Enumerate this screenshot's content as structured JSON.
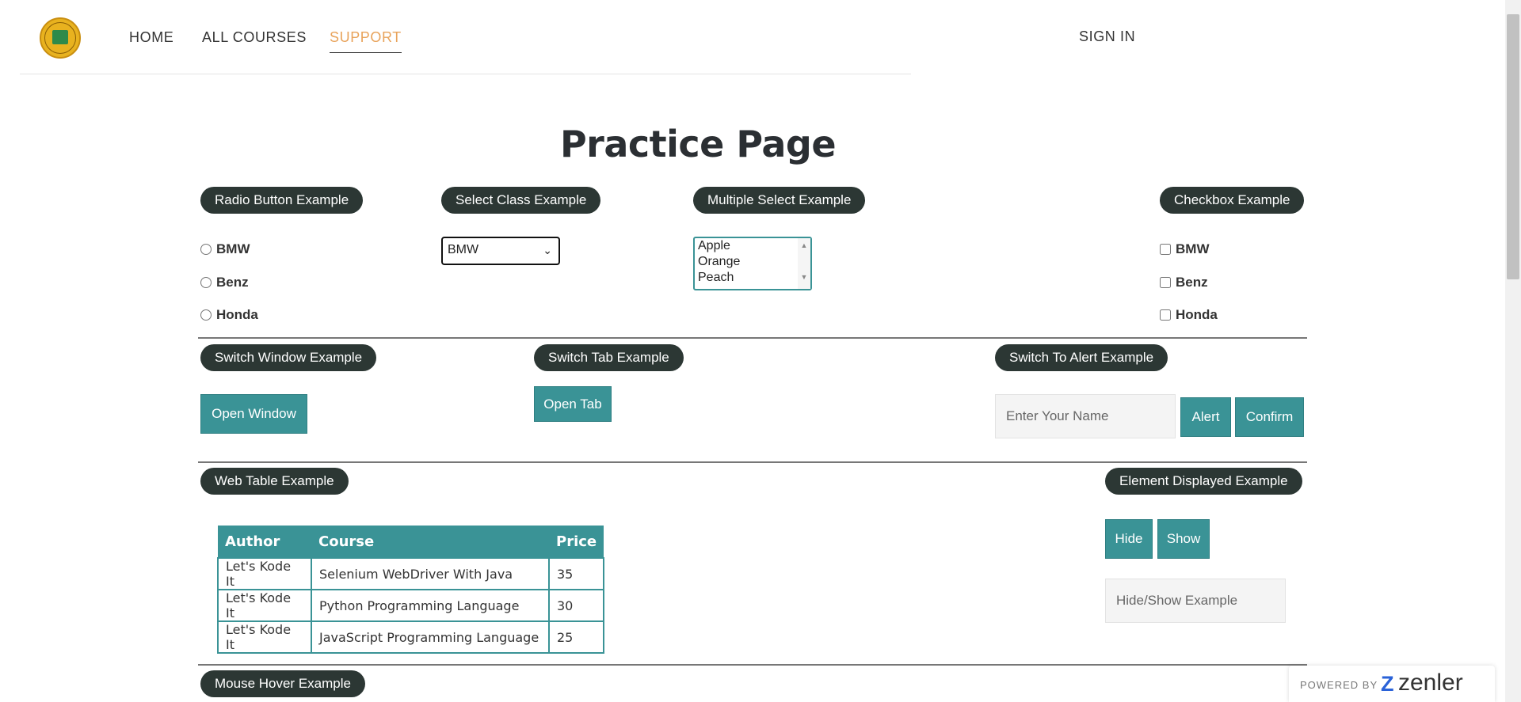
{
  "header": {
    "nav": [
      "HOME",
      "ALL COURSES",
      "SUPPORT"
    ],
    "active_nav": "SUPPORT",
    "sign_in": "SIGN IN"
  },
  "page": {
    "title": "Practice Page"
  },
  "radio": {
    "title": "Radio Button Example",
    "options": [
      "BMW",
      "Benz",
      "Honda"
    ]
  },
  "select_class": {
    "title": "Select Class Example",
    "selected": "BMW"
  },
  "multi_select": {
    "title": "Multiple Select Example",
    "options": [
      "Apple",
      "Orange",
      "Peach"
    ]
  },
  "checkbox": {
    "title": "Checkbox Example",
    "options": [
      "BMW",
      "Benz",
      "Honda"
    ]
  },
  "switch_window": {
    "title": "Switch Window Example",
    "button": "Open Window"
  },
  "switch_tab": {
    "title": "Switch Tab Example",
    "button": "Open Tab"
  },
  "alert": {
    "title": "Switch To Alert Example",
    "placeholder": "Enter Your Name",
    "alert_button": "Alert",
    "confirm_button": "Confirm"
  },
  "web_table": {
    "title": "Web Table Example",
    "headers": [
      "Author",
      "Course",
      "Price"
    ],
    "rows": [
      [
        "Let's Kode It",
        "Selenium WebDriver With Java",
        "35"
      ],
      [
        "Let's Kode It",
        "Python Programming Language",
        "30"
      ],
      [
        "Let's Kode It",
        "JavaScript Programming Language",
        "25"
      ]
    ]
  },
  "element_displayed": {
    "title": "Element Displayed Example",
    "hide": "Hide",
    "show": "Show",
    "placeholder": "Hide/Show Example"
  },
  "mouse_hover": {
    "title": "Mouse Hover Example"
  },
  "badge": {
    "powered_by": "POWERED BY",
    "brand": "zenler"
  },
  "colors": {
    "teal": "#3a9396",
    "pill": "#2c3734",
    "active_nav": "#e8a35b"
  }
}
